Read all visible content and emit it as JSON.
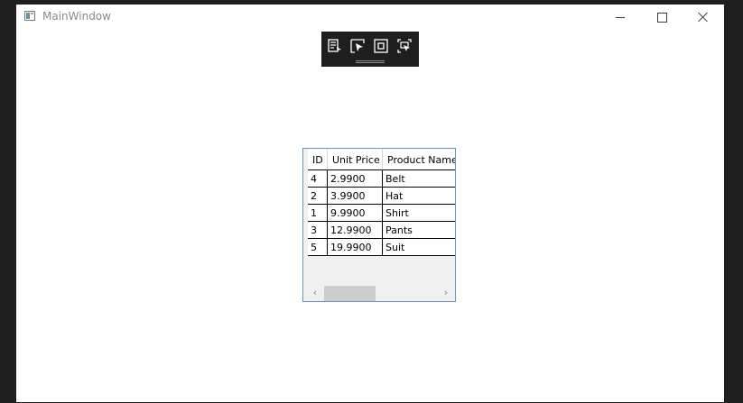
{
  "window": {
    "title": "MainWindow"
  },
  "devtools": {
    "buttons": [
      "visual-tree-icon",
      "select-element-icon",
      "display-layout-adorners-icon",
      "track-focused-element-icon"
    ]
  },
  "grid": {
    "columns": [
      "ID",
      "Unit Price",
      "Product Name"
    ],
    "rows": [
      {
        "id": "4",
        "price": "2.9900",
        "name": "Belt"
      },
      {
        "id": "2",
        "price": "3.9900",
        "name": "Hat"
      },
      {
        "id": "1",
        "price": "9.9900",
        "name": "Shirt"
      },
      {
        "id": "3",
        "price": "12.9900",
        "name": "Pants"
      },
      {
        "id": "5",
        "price": "19.9900",
        "name": "Suit"
      }
    ]
  },
  "scrollbar": {
    "left_arrow": "‹",
    "right_arrow": "›"
  }
}
